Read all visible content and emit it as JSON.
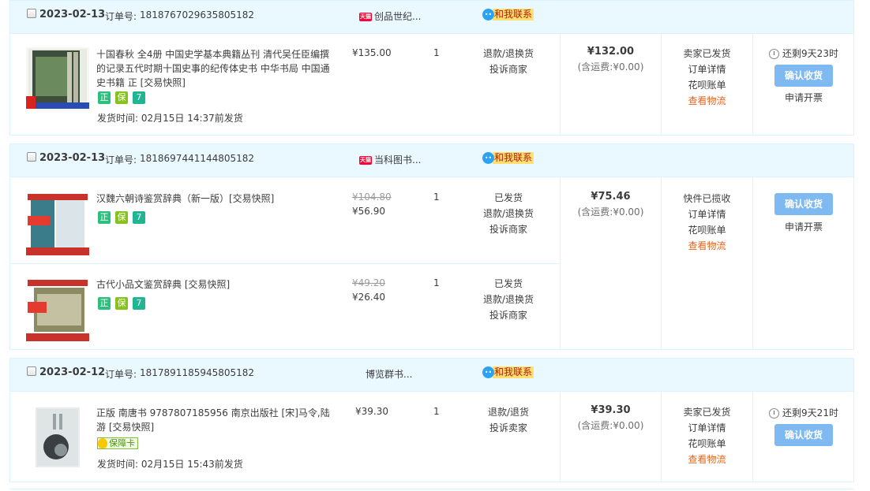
{
  "orders": [
    {
      "date": "2023-02-13",
      "order_label": "订单号:",
      "order_no": "1818767029635805182",
      "shop_badge": "天猫",
      "shop": "创品世纪...",
      "contact": "和我联系",
      "items": [
        {
          "title": "十国春秋 全4册 中国史学基本典籍丛刊 清代吴任臣编撰的记录五代时期十国史事的纪传体史书 中华书局 中国通史书籍 正 [交易快照]",
          "badges": [
            "正",
            "保",
            "7"
          ],
          "ship_time": "发货时间: 02月15日 14:37前发货",
          "price": "¥135.00",
          "qty": "1",
          "ops": [
            "退款/退换货",
            "投诉商家"
          ]
        }
      ],
      "total": "¥132.00",
      "shipping": "(含运费:¥0.00)",
      "status": [
        "卖家已发货",
        "订单详情",
        "花呗账单"
      ],
      "status_link": "查看物流",
      "remain": "还剩9天23时",
      "confirm": "确认收货",
      "invoice": "申请开票"
    },
    {
      "date": "2023-02-13",
      "order_label": "订单号:",
      "order_no": "1818697441144805182",
      "shop_badge": "天猫",
      "shop": "当科图书...",
      "contact": "和我联系",
      "items": [
        {
          "title": "汉魏六朝诗鉴赏辞典（新一版）[交易快照]",
          "badges": [
            "正",
            "保",
            "7"
          ],
          "orig_price": "¥104.80",
          "price": "¥56.90",
          "qty": "1",
          "ops": [
            "已发货",
            "退款/退换货",
            "投诉商家"
          ]
        },
        {
          "title": "古代小品文鉴赏辞典 [交易快照]",
          "badges": [
            "正",
            "保",
            "7"
          ],
          "orig_price": "¥49.20",
          "price": "¥26.40",
          "qty": "1",
          "ops": [
            "已发货",
            "退款/退换货",
            "投诉商家"
          ]
        }
      ],
      "total": "¥75.46",
      "shipping": "(含运费:¥0.00)",
      "status": [
        "快件已揽收",
        "订单详情",
        "花呗账单"
      ],
      "status_link": "查看物流",
      "confirm": "确认收货",
      "invoice": "申请开票"
    },
    {
      "date": "2023-02-12",
      "order_label": "订单号:",
      "order_no": "1817891185945805182",
      "shop": "博览群书...",
      "contact": "和我联系",
      "items": [
        {
          "title": "正版 南唐书 9787807185956 南京出版社 [宋]马令,陆游 [交易快照]",
          "guarantee": "保障卡",
          "ship_time": "发货时间: 02月15日 15:43前发货",
          "price": "¥39.30",
          "qty": "1",
          "ops": [
            "退款/退货",
            "投诉卖家"
          ]
        }
      ],
      "total": "¥39.30",
      "shipping": "(含运费:¥0.00)",
      "status": [
        "卖家已发货",
        "订单详情",
        "花呗账单"
      ],
      "status_link": "查看物流",
      "remain": "还剩9天21时",
      "confirm": "确认收货"
    }
  ]
}
